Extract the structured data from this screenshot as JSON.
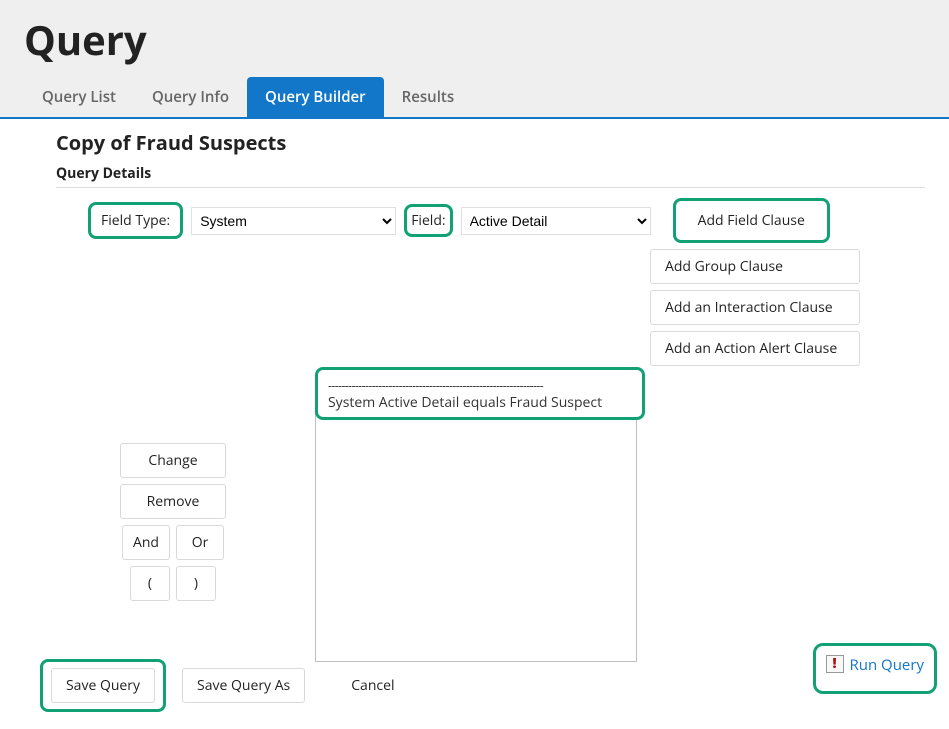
{
  "page_title": "Query",
  "tabs": [
    "Query List",
    "Query Info",
    "Query Builder",
    "Results"
  ],
  "active_tab_index": 2,
  "subtitle": "Copy of Fraud Suspects",
  "section_label": "Query Details",
  "labels": {
    "field_type": "Field Type:",
    "field": "Field:"
  },
  "selects": {
    "field_type_value": "System",
    "field_value": "Active Detail"
  },
  "buttons": {
    "add_field_clause": "Add Field Clause",
    "add_group_clause": "Add Group Clause",
    "add_interaction_clause": "Add an Interaction Clause",
    "add_action_alert_clause": "Add an Action Alert Clause",
    "change": "Change",
    "remove": "Remove",
    "and": "And",
    "or": "Or",
    "open_paren": "(",
    "close_paren": ")",
    "save_query": "Save Query",
    "save_query_as": "Save Query As",
    "cancel": "Cancel",
    "run_query": "Run Query"
  },
  "clause_listbox": {
    "divider": "----------------------------------------------------------------",
    "clause": "System Active Detail equals Fraud Suspect"
  },
  "icons": {
    "run_exclaim": "!"
  }
}
